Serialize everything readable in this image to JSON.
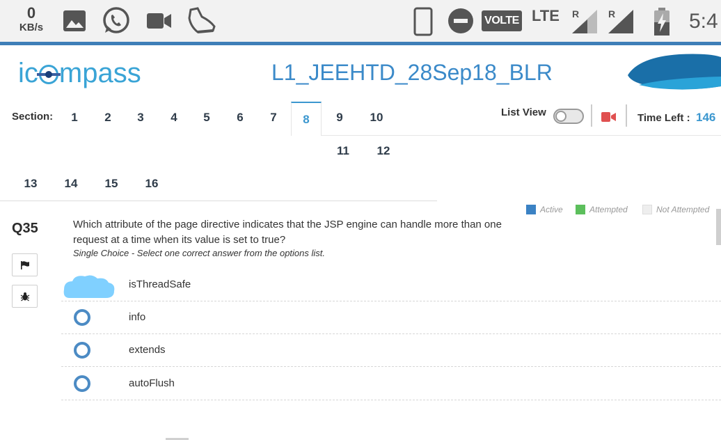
{
  "status_bar": {
    "speed_value": "0",
    "speed_unit": "KB/s",
    "volte": "VOLTE",
    "network": "LTE",
    "roaming_1": "R",
    "roaming_2": "R",
    "time": "5:4",
    "icons": [
      "gallery-icon",
      "whatsapp-icon",
      "video-camera-icon",
      "sneaker-icon",
      "phone-icon",
      "do-not-disturb-icon",
      "signal-icon",
      "battery-charging-icon"
    ]
  },
  "header": {
    "logo_prefix": "ic",
    "logo_suffix": "mpass",
    "exam_title": "L1_JEEHTD_28Sep18_BLR"
  },
  "sections": {
    "label": "Section:",
    "items": [
      "1",
      "2",
      "3",
      "4",
      "5",
      "6",
      "7",
      "8",
      "9",
      "10",
      "11",
      "12",
      "13",
      "14",
      "15",
      "16"
    ],
    "active": "8"
  },
  "controls": {
    "list_view_label": "List View",
    "list_view_on": false,
    "time_left_label": "Time Left :",
    "time_left_value": "146"
  },
  "legend": {
    "active": "Active",
    "attempted": "Attempted",
    "not_attempted": "Not Attempted",
    "colors": {
      "active": "#3b82c4",
      "attempted": "#5cbf5c",
      "not_attempted": "#eeeeee"
    }
  },
  "question": {
    "number": "Q35",
    "text": "Which attribute of the page directive indicates that the JSP engine can handle more than one request at a time when its value is set to true?",
    "hint": "Single Choice - Select one correct answer from the options list.",
    "options": [
      "isThreadSafe",
      "info",
      "extends",
      "autoFlush"
    ]
  },
  "colors": {
    "accent": "#3b97cf",
    "radio": "#4c8bc4",
    "statusbar_line": "#3f7fb8"
  }
}
